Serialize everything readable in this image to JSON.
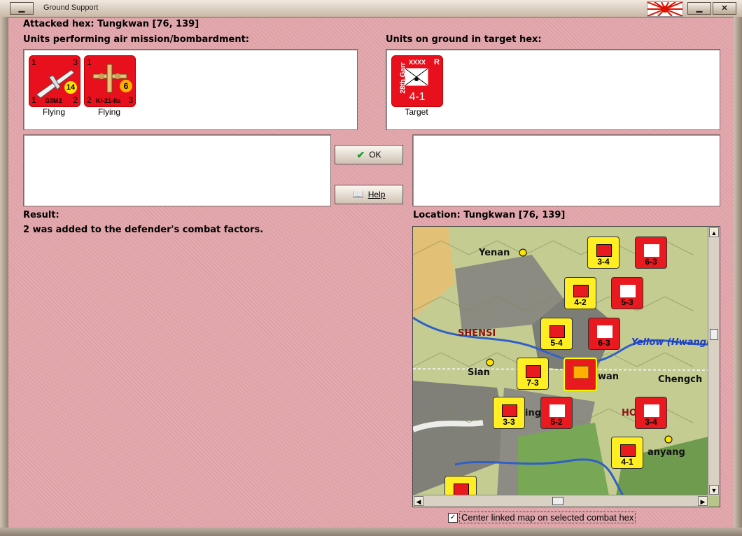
{
  "window": {
    "title": "Ground Support"
  },
  "header": {
    "attacked_hex": "Attacked hex: Tungkwan  [76, 139]"
  },
  "air_units": {
    "label": "Units performing air mission/bombardment:",
    "units": [
      {
        "name": "G3M2",
        "status": "Flying",
        "tl": "1",
        "tr": "3",
        "bl": "1",
        "br": "2",
        "badge": "14"
      },
      {
        "name": "Ki-21-IIa",
        "status": "Flying",
        "tl": "1",
        "tr": "",
        "bl": "2",
        "br": "3",
        "badge": "6"
      }
    ]
  },
  "ground_units": {
    "label": "Units on ground in target hex:",
    "units": [
      {
        "name": "28th Garr",
        "size": "XXXX",
        "mark": "R",
        "factors": "4-1",
        "status": "Target"
      }
    ]
  },
  "buttons": {
    "ok": "OK",
    "help": "Help"
  },
  "result": {
    "label": "Result:",
    "text": "2 was added to the defender's combat factors."
  },
  "location": {
    "label": "Location:  Tungkwan  [76, 139]"
  },
  "map": {
    "cities": [
      "Yenan",
      "SHENSI",
      "Yellow (Hwangh",
      "Sian",
      "wan",
      "Chengch",
      "ing",
      "HO",
      "anyang"
    ],
    "units": [
      {
        "factors": "3-4",
        "color": "yellow"
      },
      {
        "factors": "6-3",
        "color": "red"
      },
      {
        "factors": "4-2",
        "color": "yellow"
      },
      {
        "factors": "5-3",
        "color": "red"
      },
      {
        "factors": "5-4",
        "color": "yellow"
      },
      {
        "factors": "6-3",
        "color": "red"
      },
      {
        "factors": "7-3",
        "color": "yellow"
      },
      {
        "factors": "3-3",
        "color": "yellow"
      },
      {
        "factors": "5-2",
        "color": "red"
      },
      {
        "factors": "3-4",
        "color": "red"
      },
      {
        "factors": "4-1",
        "color": "yellow"
      }
    ]
  },
  "footer": {
    "center_map_label": "Center linked map on selected combat hex",
    "center_map_checked": "✓"
  }
}
